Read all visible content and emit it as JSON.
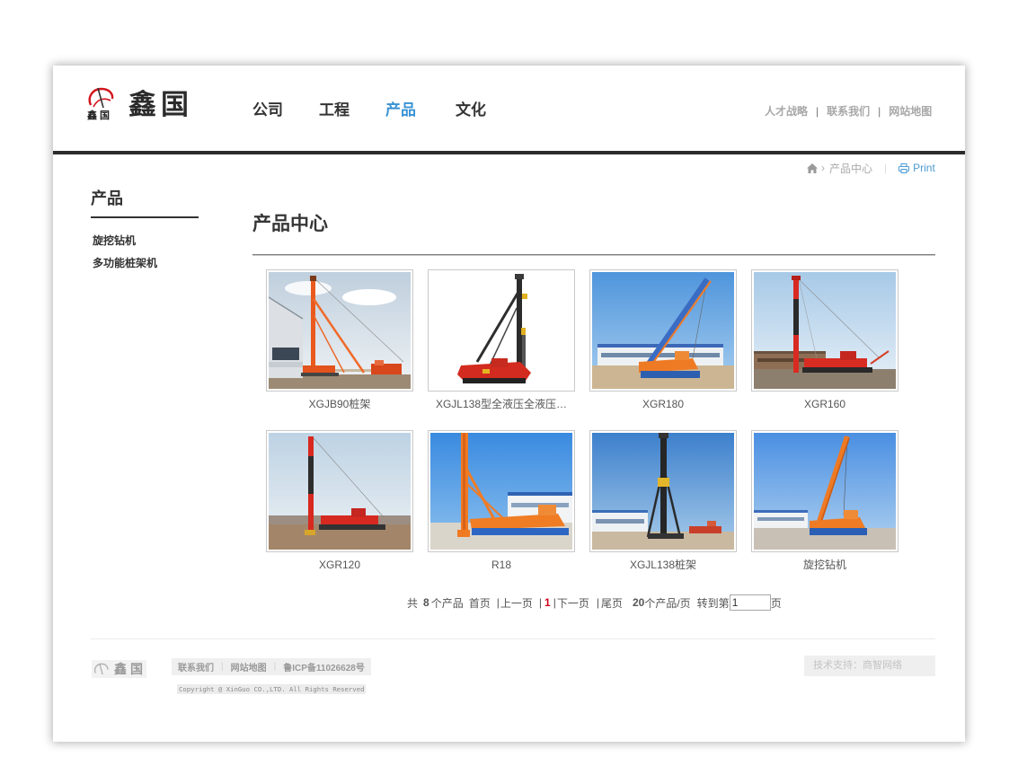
{
  "header": {
    "logo_mark_text": "鑫 国",
    "logo_text": "鑫国",
    "nav": [
      "公司",
      "工程",
      "产品",
      "文化"
    ],
    "utility_links": [
      "人才战略",
      "联系我们",
      "网站地图"
    ],
    "separator": "|"
  },
  "breadcrumb": {
    "home_icon": "home-icon",
    "arrow": "›",
    "current": "产品中心",
    "separator": "|",
    "print_icon": "printer-icon",
    "print_label": "Print"
  },
  "sidebar": {
    "title": "产品",
    "items": [
      "旋挖钻机",
      "多功能桩架机"
    ]
  },
  "main": {
    "title": "产品中心",
    "products": [
      {
        "name": "XGJB90桩架"
      },
      {
        "name": "XGJL138型全液压全液压…"
      },
      {
        "name": "XGR180"
      },
      {
        "name": "XGR160"
      },
      {
        "name": "XGR120"
      },
      {
        "name": "R18"
      },
      {
        "name": "XGJL138桩架"
      },
      {
        "name": "旋挖钻机"
      }
    ]
  },
  "pagination": {
    "total_prefix": "共",
    "total": "8",
    "total_suffix": "个产品",
    "first": "首页",
    "prev": "上一页",
    "current": "1",
    "next": "下一页",
    "last": "尾页",
    "per_page": "20",
    "per_page_suffix": "个产品/页",
    "goto_prefix": "转到第",
    "goto_value": "1",
    "goto_suffix": "页",
    "separator": "|"
  },
  "footer": {
    "logo_text": "鑫国",
    "links": [
      "联系我们",
      "网站地图",
      "鲁ICP备11026628号"
    ],
    "separator": "|",
    "copyright": "Copyright @ XinGuo CO.,LTD. All Rights Reserved",
    "tech_support": "技术支持：商智网络"
  },
  "colors": {
    "text": "#333333",
    "nav_active": "#3a93d3",
    "link_blue": "#4a9ad4",
    "current_page": "#d0021b",
    "muted": "#a8a8a8",
    "header_rule": "#2b2b2b"
  }
}
